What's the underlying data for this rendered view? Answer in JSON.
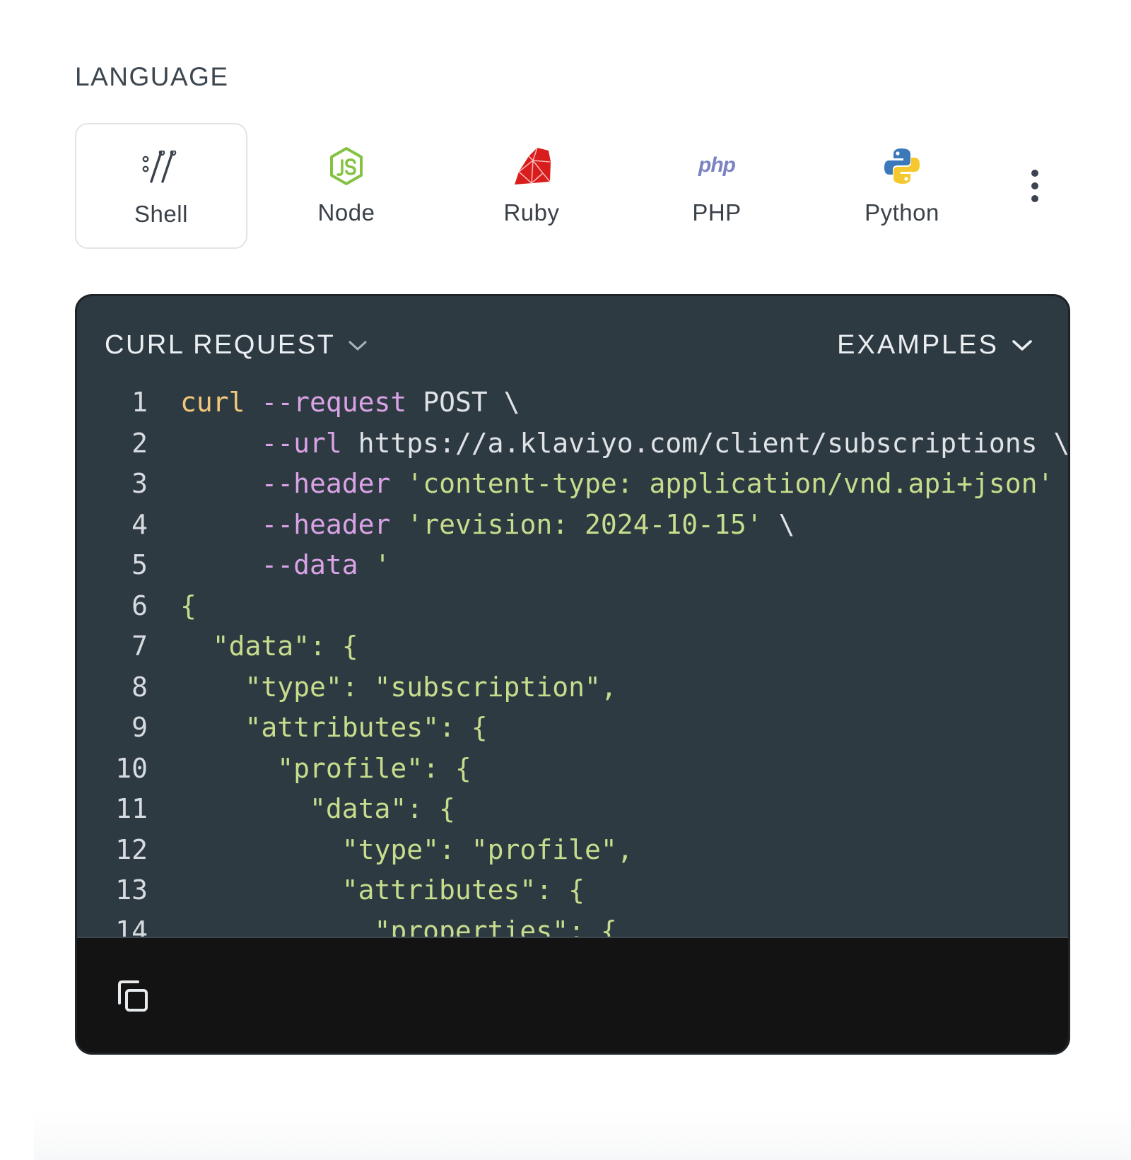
{
  "section_label": "LANGUAGE",
  "languages": [
    {
      "name": "Shell",
      "icon": "shell-icon",
      "active": true
    },
    {
      "name": "Node",
      "icon": "nodejs-icon",
      "active": false
    },
    {
      "name": "Ruby",
      "icon": "ruby-icon",
      "active": false
    },
    {
      "name": "PHP",
      "icon": "php-icon",
      "active": false
    },
    {
      "name": "Python",
      "icon": "python-icon",
      "active": false
    }
  ],
  "php_logo_text": "php",
  "more_icon": "more-vertical-icon",
  "code_panel": {
    "title": "CURL REQUEST",
    "examples_label": "EXAMPLES",
    "copy_icon": "copy-icon",
    "lines": [
      {
        "num": "1",
        "segments": [
          {
            "t": "curl",
            "c": "cmd"
          },
          {
            "t": " ",
            "c": "plain"
          },
          {
            "t": "--request",
            "c": "flag"
          },
          {
            "t": " POST \\",
            "c": "plain"
          }
        ]
      },
      {
        "num": "2",
        "segments": [
          {
            "t": "     ",
            "c": "plain"
          },
          {
            "t": "--url",
            "c": "flag"
          },
          {
            "t": " https://a.klaviyo.com/client/subscriptions \\",
            "c": "plain"
          }
        ]
      },
      {
        "num": "3",
        "segments": [
          {
            "t": "     ",
            "c": "plain"
          },
          {
            "t": "--header",
            "c": "flag"
          },
          {
            "t": " ",
            "c": "plain"
          },
          {
            "t": "'content-type: application/vnd.api+json'",
            "c": "str"
          },
          {
            "t": " \\",
            "c": "plain"
          }
        ]
      },
      {
        "num": "4",
        "segments": [
          {
            "t": "     ",
            "c": "plain"
          },
          {
            "t": "--header",
            "c": "flag"
          },
          {
            "t": " ",
            "c": "plain"
          },
          {
            "t": "'revision: 2024-10-15'",
            "c": "str"
          },
          {
            "t": " \\",
            "c": "plain"
          }
        ]
      },
      {
        "num": "5",
        "segments": [
          {
            "t": "     ",
            "c": "plain"
          },
          {
            "t": "--data",
            "c": "flag"
          },
          {
            "t": " ",
            "c": "plain"
          },
          {
            "t": "'",
            "c": "str"
          }
        ]
      },
      {
        "num": "6",
        "segments": [
          {
            "t": "{",
            "c": "str"
          }
        ]
      },
      {
        "num": "7",
        "segments": [
          {
            "t": "  \"data\": {",
            "c": "str"
          }
        ]
      },
      {
        "num": "8",
        "segments": [
          {
            "t": "    \"type\": \"subscription\",",
            "c": "str"
          }
        ]
      },
      {
        "num": "9",
        "segments": [
          {
            "t": "    \"attributes\": {",
            "c": "str"
          }
        ]
      },
      {
        "num": "10",
        "segments": [
          {
            "t": "      \"profile\": {",
            "c": "str"
          }
        ]
      },
      {
        "num": "11",
        "segments": [
          {
            "t": "        \"data\": {",
            "c": "str"
          }
        ]
      },
      {
        "num": "12",
        "segments": [
          {
            "t": "          \"type\": \"profile\",",
            "c": "str"
          }
        ]
      },
      {
        "num": "13",
        "segments": [
          {
            "t": "          \"attributes\": {",
            "c": "str"
          }
        ]
      },
      {
        "num": "14",
        "segments": [
          {
            "t": "            \"properties\": {",
            "c": "str"
          }
        ]
      }
    ]
  }
}
